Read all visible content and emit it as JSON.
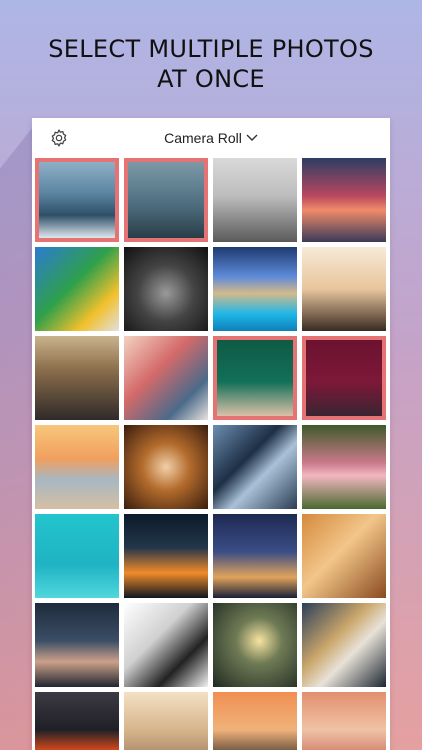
{
  "headline": {
    "line1": "SELECT MULTIPLE PHOTOS",
    "line2": "AT ONCE"
  },
  "topbar": {
    "title": "Camera Roll",
    "settings_icon": "gear-icon",
    "dropdown_icon": "chevron-down-icon"
  },
  "colors": {
    "selection_border": "#e57373",
    "bg_top": "#aeb6e6",
    "bg_bottom": "#e5a0a0"
  },
  "photos": [
    {
      "subject": "woman-on-boat-deck",
      "selected": true
    },
    {
      "subject": "woman-looking-at-sea",
      "selected": true
    },
    {
      "subject": "bw-pine-trees",
      "selected": false
    },
    {
      "subject": "harbor-sunset-boats",
      "selected": false
    },
    {
      "subject": "macaw-parrot",
      "selected": false
    },
    {
      "subject": "bw-finger-to-lips",
      "selected": false
    },
    {
      "subject": "modern-house-pool",
      "selected": false
    },
    {
      "subject": "climbers-silhouette",
      "selected": false
    },
    {
      "subject": "concert-crowd",
      "selected": false
    },
    {
      "subject": "man-in-cap",
      "selected": false
    },
    {
      "subject": "woman-green-door",
      "selected": true
    },
    {
      "subject": "twins-red-wall",
      "selected": true
    },
    {
      "subject": "couple-on-beach",
      "selected": false
    },
    {
      "subject": "woman-fur-hood-lights",
      "selected": false
    },
    {
      "subject": "skyscrapers-looking-up",
      "selected": false
    },
    {
      "subject": "woman-lying-grass",
      "selected": false
    },
    {
      "subject": "person-turquoise-water",
      "selected": false
    },
    {
      "subject": "city-light-trails",
      "selected": false
    },
    {
      "subject": "louvre-night",
      "selected": false
    },
    {
      "subject": "girl-with-cap",
      "selected": false
    },
    {
      "subject": "woman-in-hood",
      "selected": false
    },
    {
      "subject": "bw-hair-art",
      "selected": false
    },
    {
      "subject": "person-with-sparkler",
      "selected": false
    },
    {
      "subject": "woman-with-lights",
      "selected": false
    },
    {
      "subject": "lava-volcano",
      "selected": false
    },
    {
      "subject": "woman-blonde-hair",
      "selected": false
    },
    {
      "subject": "smoke-sunset",
      "selected": false
    },
    {
      "subject": "smiling-woman",
      "selected": false
    }
  ]
}
